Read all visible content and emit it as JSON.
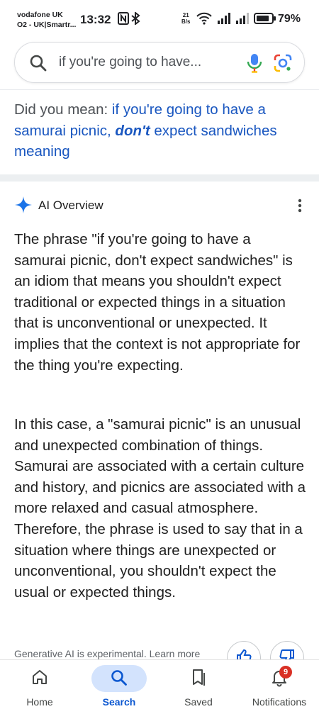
{
  "status_bar": {
    "carrier_line1": "vodafone UK",
    "carrier_line2": "O2 - UK|Smartr...",
    "time": "13:32",
    "net_speed_value": "21",
    "net_speed_unit": "B/s",
    "battery": "79%"
  },
  "search": {
    "query": "if you're going to have..."
  },
  "did_you_mean": {
    "prefix": "Did you mean: ",
    "link_part1": "if you're going to have a samurai picnic, ",
    "link_emphasis": "don't",
    "link_part2": " expect sandwiches meaning"
  },
  "ai_overview": {
    "title": "AI Overview",
    "paragraph_1": "The phrase \"if you're going to have a samurai picnic, don't expect sandwiches\" is an idiom that means you shouldn't expect traditional or expected things in a situation that is unconventional or unexpected. It implies that the context is not appropriate for the thing you're expecting.",
    "paragraph_2": "In this case, a \"samurai picnic\" is an unusual and unexpected combination of things. Samurai are associated with a certain culture and history, and picnics are associated with a more relaxed and casual atmosphere. Therefore, the phrase is used to say that in a situation where things are unexpected or unconventional, you shouldn't expect the usual or expected things.",
    "footer_note": "Generative AI is experimental. Learn more"
  },
  "bottom_nav": {
    "items": [
      {
        "label": "Home",
        "icon": "home-icon"
      },
      {
        "label": "Search",
        "icon": "search-icon",
        "active": true
      },
      {
        "label": "Saved",
        "icon": "bookmark-icon"
      },
      {
        "label": "Notifications",
        "icon": "bell-icon"
      }
    ],
    "notification_count": "9"
  },
  "colors": {
    "link_blue": "#1a57c0",
    "active_nav_pill": "#d3e3fd",
    "active_nav_text": "#0b57d0",
    "badge_red": "#d93025"
  }
}
